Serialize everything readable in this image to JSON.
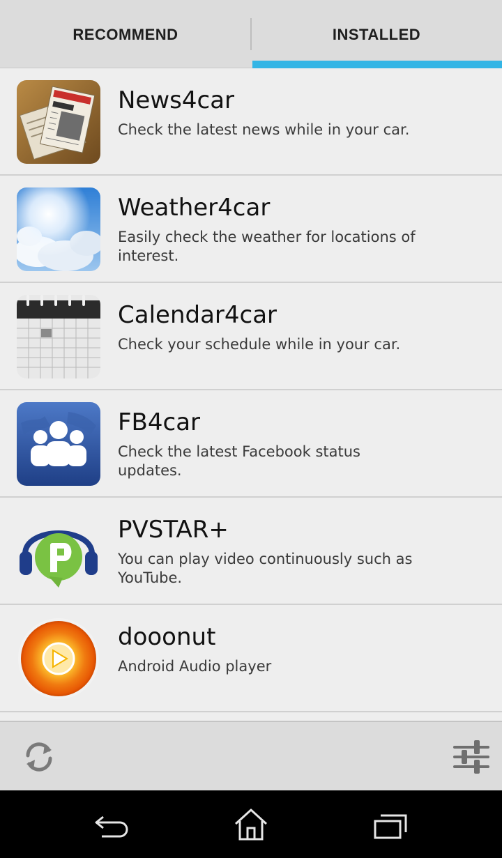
{
  "tabs": [
    {
      "label": "RECOMMEND",
      "active": false
    },
    {
      "label": "INSTALLED",
      "active": true
    }
  ],
  "accent_color": "#33b5e5",
  "apps": [
    {
      "title": "News4car",
      "description": "Check the latest news while in your car.",
      "icon": "newspaper-icon"
    },
    {
      "title": "Weather4car",
      "description": "Easily check the weather for locations of interest.",
      "icon": "sky-clouds-icon"
    },
    {
      "title": "Calendar4car",
      "description": "Check your schedule while in your car.",
      "icon": "calendar-icon"
    },
    {
      "title": "FB4car",
      "description": "Check the latest Facebook status updates.",
      "icon": "people-globe-icon"
    },
    {
      "title": "PVSTAR+",
      "description": "You can play video continuously such as YouTube.",
      "icon": "headphones-p-icon"
    },
    {
      "title": "dooonut",
      "description": "Android Audio player",
      "icon": "disc-play-icon"
    }
  ],
  "bottom_bar": {
    "left_icon": "refresh-icon",
    "right_icon": "sliders-icon"
  },
  "nav_bar": {
    "icons": [
      "back-icon",
      "home-icon",
      "recent-apps-icon"
    ]
  }
}
